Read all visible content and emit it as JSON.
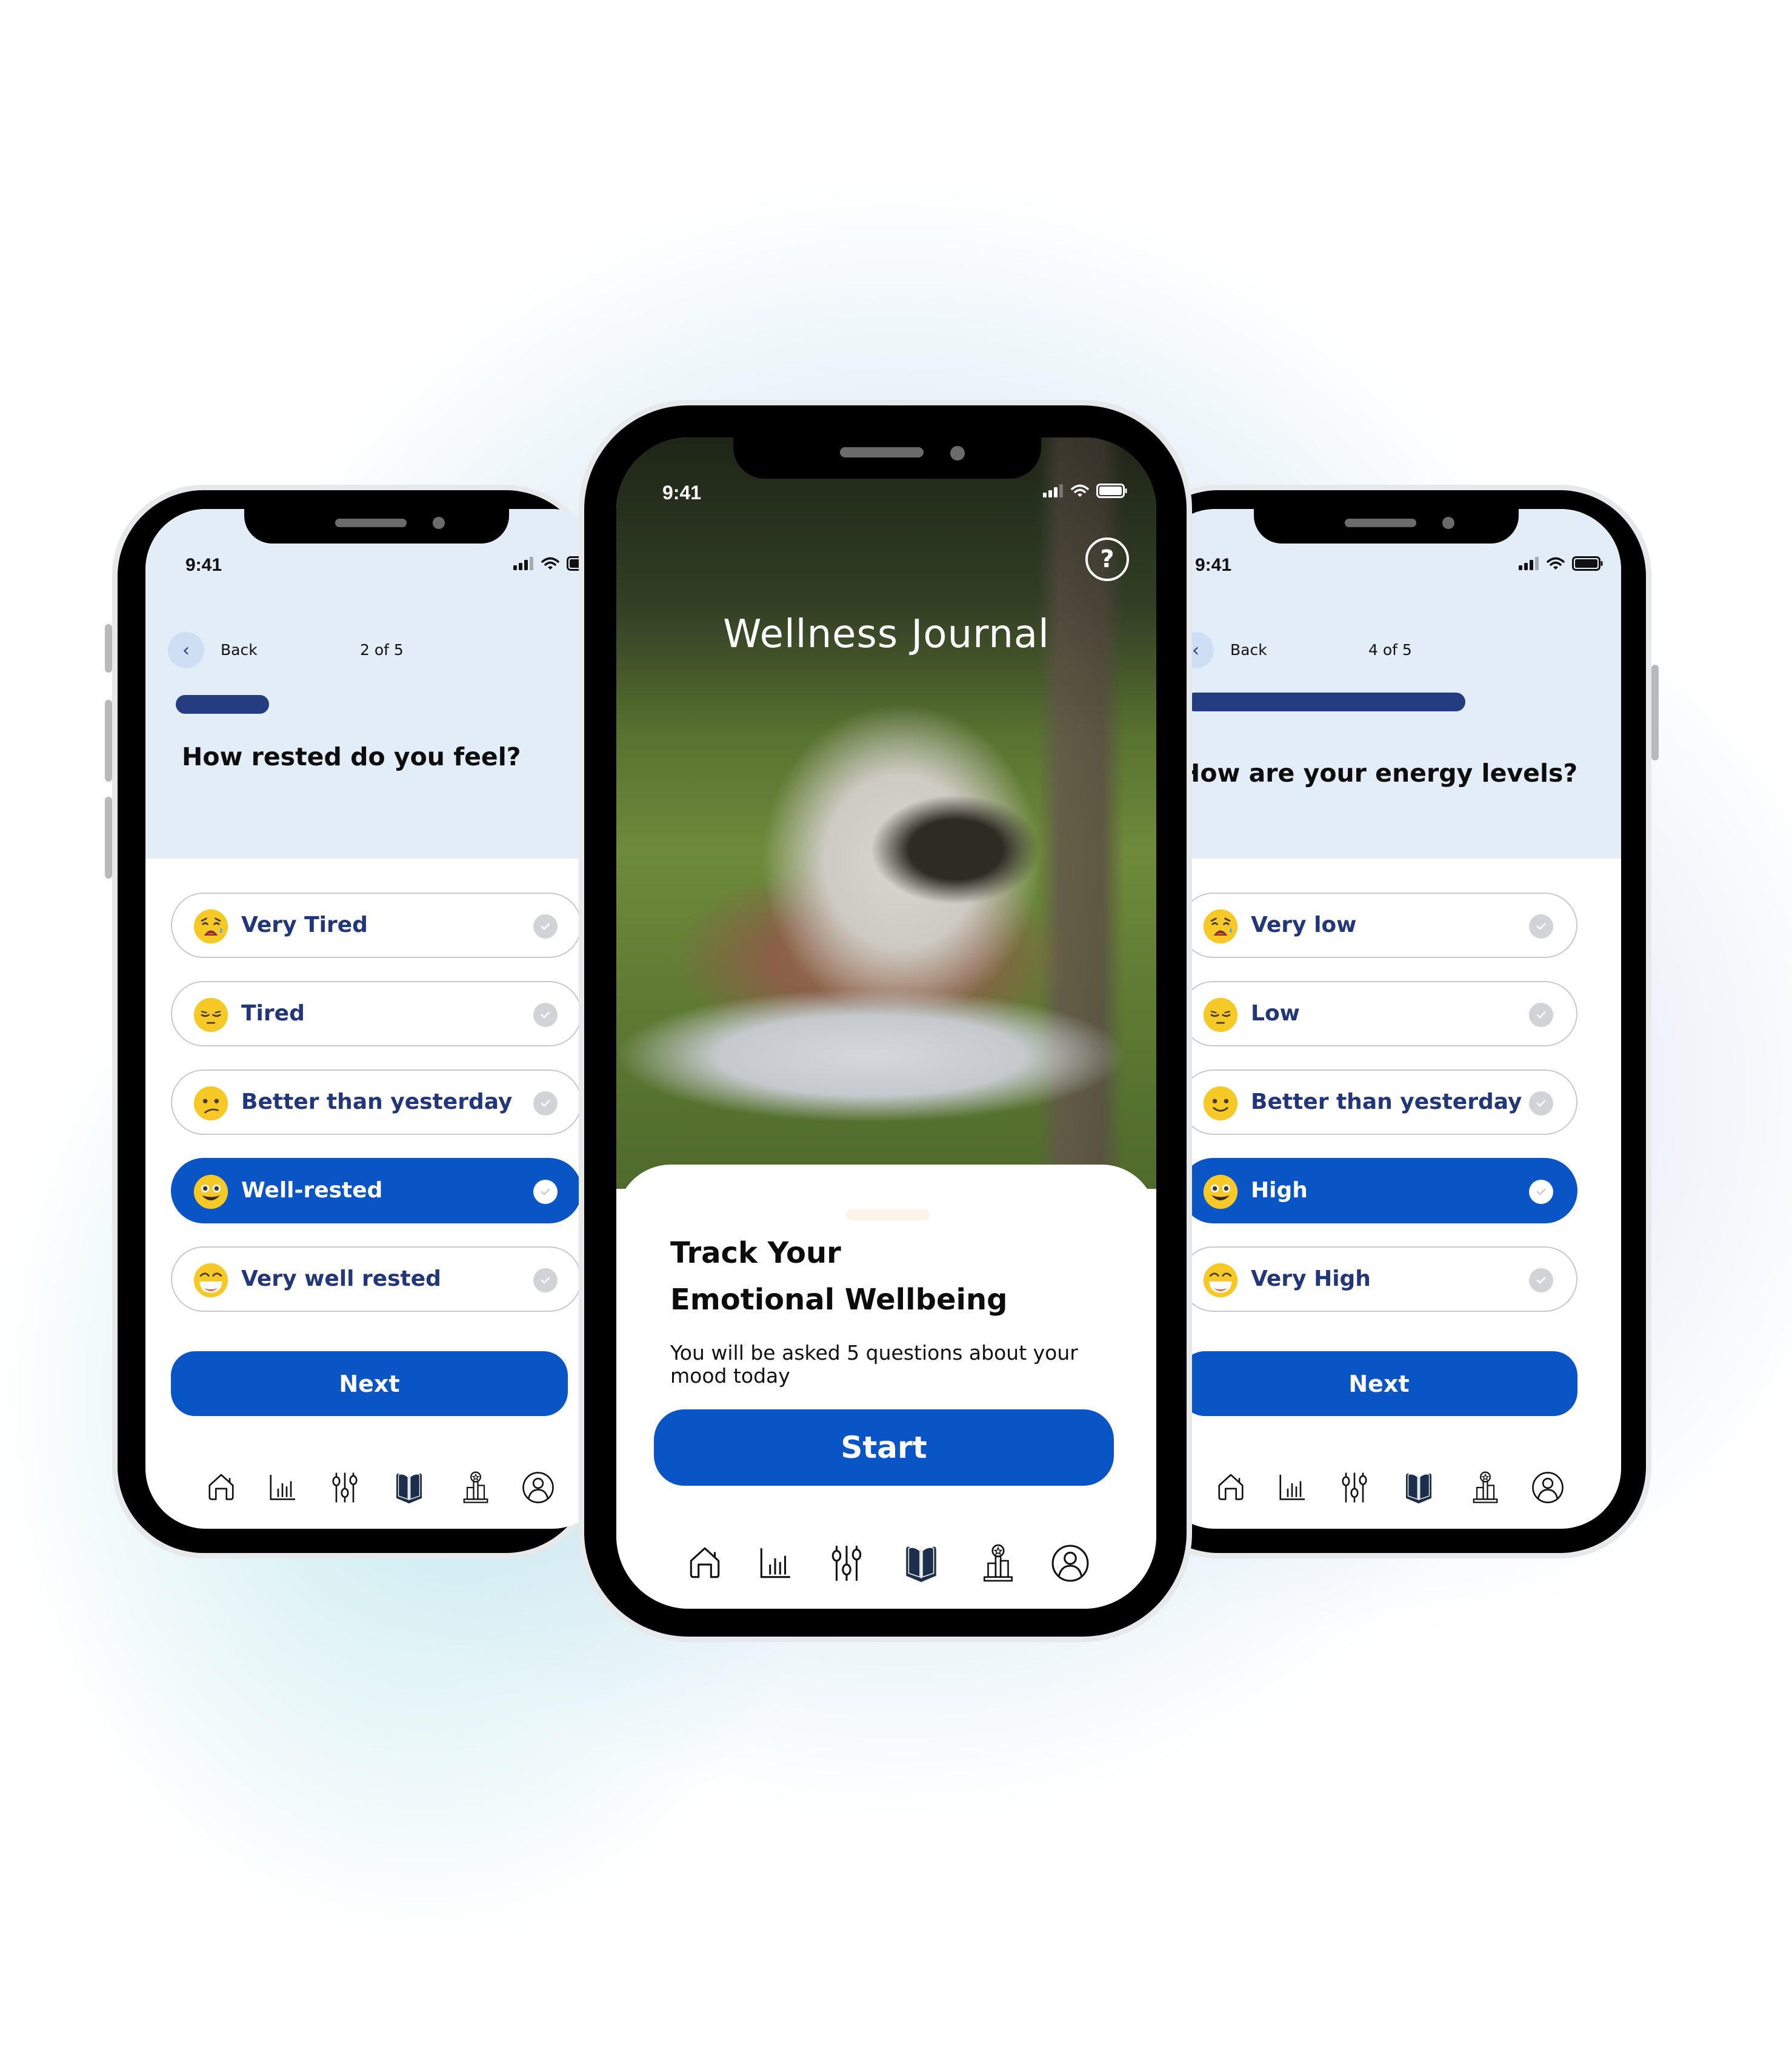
{
  "status_bar": {
    "time": "9:41"
  },
  "nav_items": [
    {
      "id": "home",
      "icon": "home-icon",
      "active": false
    },
    {
      "id": "stats",
      "icon": "bar-chart-icon",
      "active": false
    },
    {
      "id": "adjust",
      "icon": "sliders-icon",
      "active": false
    },
    {
      "id": "journal",
      "icon": "book-icon",
      "active": true
    },
    {
      "id": "achievements",
      "icon": "podium-award-icon",
      "active": false
    },
    {
      "id": "profile",
      "icon": "user-circle-icon",
      "active": false
    }
  ],
  "left_screen": {
    "back_label": "Back",
    "step_label": "2 of 5",
    "progress_fraction": 0.23,
    "question": "How rested do you feel?",
    "options": [
      {
        "label": "Very Tired",
        "emoji": "weary-face",
        "selected": false
      },
      {
        "label": "Tired",
        "emoji": "pensive-face",
        "selected": false
      },
      {
        "label": "Better than yesterday",
        "emoji": "confused-face",
        "selected": false
      },
      {
        "label": "Well-rested",
        "emoji": "grinning-face",
        "selected": true
      },
      {
        "label": "Very well rested",
        "emoji": "laughing-face",
        "selected": false
      }
    ],
    "next_label": "Next"
  },
  "center_screen": {
    "app_title": "Wellness Journal",
    "help_icon": "question-circle-icon",
    "card_title_line1": "Track Your",
    "card_title_line2": "Emotional Wellbeing",
    "card_subtitle": "You will be asked 5 questions about your mood today",
    "start_label": "Start"
  },
  "right_screen": {
    "back_label": "Back",
    "step_label": "4 of 5",
    "progress_fraction": 0.69,
    "question": "How are your energy levels?",
    "options": [
      {
        "label": "Very low",
        "emoji": "weary-face",
        "selected": false
      },
      {
        "label": "Low",
        "emoji": "pensive-face",
        "selected": false
      },
      {
        "label": "Better than yesterday",
        "emoji": "smiling-face",
        "selected": false
      },
      {
        "label": "High",
        "emoji": "grinning-face",
        "selected": true
      },
      {
        "label": "Very High",
        "emoji": "laughing-face",
        "selected": false
      }
    ],
    "next_label": "Next"
  },
  "colors": {
    "primary": "#0a55c6",
    "progress": "#243d80",
    "option_text": "#22367a",
    "header_bg": "#e3edf8",
    "check_inactive": "#d2d3d6"
  }
}
